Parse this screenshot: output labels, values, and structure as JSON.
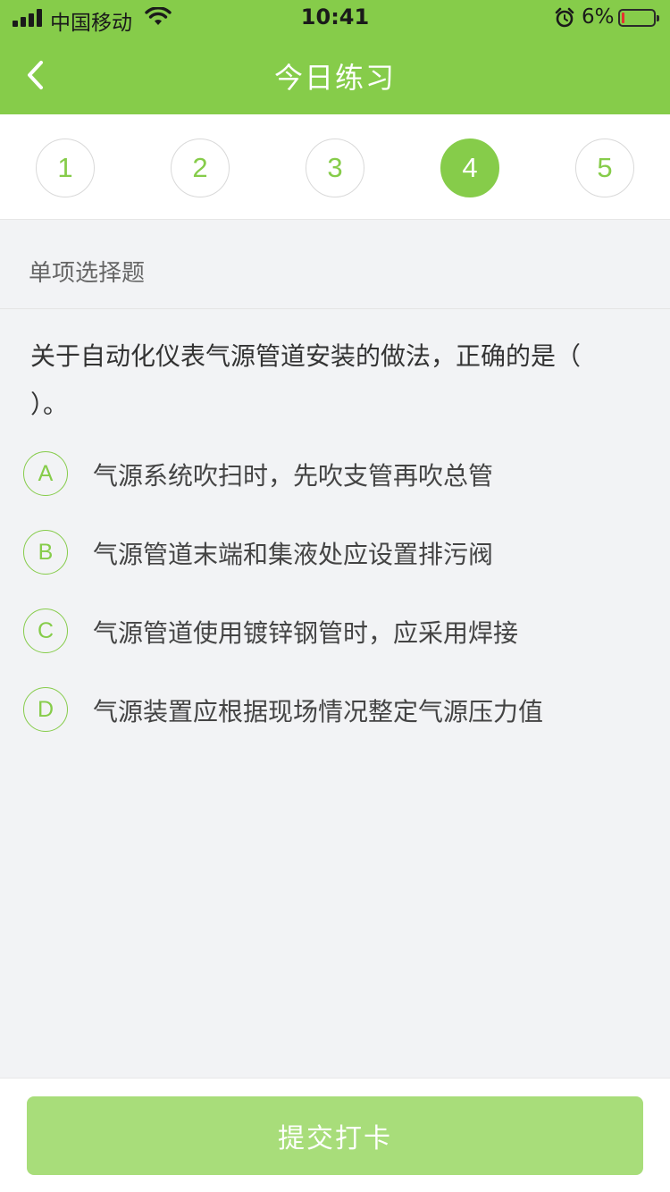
{
  "status_bar": {
    "carrier": "中国移动",
    "time": "10:41",
    "battery": "6%",
    "battery_level": 0.06
  },
  "nav": {
    "title": "今日练习",
    "back_icon": "chevron-left-icon"
  },
  "steps": {
    "items": [
      "1",
      "2",
      "3",
      "4",
      "5"
    ],
    "active": "4"
  },
  "question": {
    "type": "单项选择题",
    "text": "关于自动化仪表气源管道安装的做法，正确的是（   ）。",
    "options": [
      {
        "letter": "A",
        "text": "气源系统吹扫时，先吹支管再吹总管"
      },
      {
        "letter": "B",
        "text": "气源管道末端和集液处应设置排污阀"
      },
      {
        "letter": "C",
        "text": "气源管道使用镀锌钢管时，应采用焊接"
      },
      {
        "letter": "D",
        "text": "气源装置应根据现场情况整定气源压力值"
      }
    ]
  },
  "footer": {
    "submit_label": "提交打卡"
  },
  "colors": {
    "accent": "#86cc4a",
    "submit_disabled": "#a8dd7a",
    "background": "#f2f3f5"
  }
}
